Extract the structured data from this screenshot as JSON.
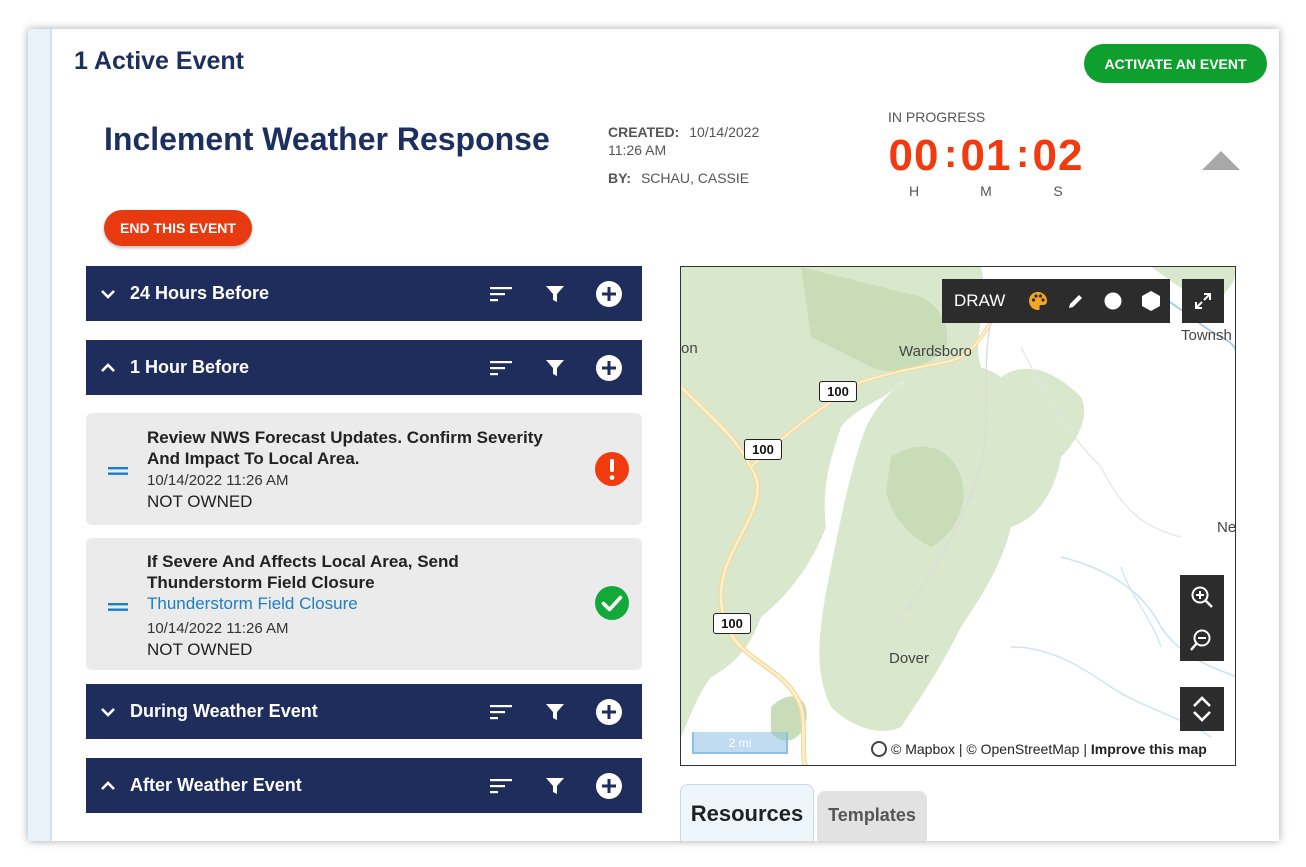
{
  "header": {
    "page_title": "1 Active Event",
    "activate_label": "ACTIVATE AN EVENT"
  },
  "event": {
    "name": "Inclement Weather Response",
    "created_label": "CREATED:",
    "created_date": "10/14/2022",
    "created_time": "11:26 AM",
    "by_label": "BY:",
    "by_value": "SCHAU, CASSIE",
    "status_label": "IN PROGRESS",
    "timer": {
      "h": "00",
      "m": "01",
      "s": "02",
      "h_label": "H",
      "m_label": "M",
      "s_label": "S"
    },
    "end_label": "END THIS EVENT"
  },
  "phases": [
    {
      "title": "24 Hours Before",
      "expanded": false
    },
    {
      "title": "1 Hour Before",
      "expanded": true
    },
    {
      "title": "During Weather Event",
      "expanded": false
    },
    {
      "title": "After Weather Event",
      "expanded": true
    }
  ],
  "tasks": [
    {
      "title": "Review NWS Forecast Updates. Confirm Severity And Impact To Local Area.",
      "link": "",
      "date": "10/14/2022 11:26 AM",
      "owner": "NOT OWNED",
      "status": "alert"
    },
    {
      "title": "If Severe And Affects Local Area, Send Thunderstorm Field Closure",
      "link": "Thunderstorm Field Closure",
      "date": "10/14/2022 11:26 AM",
      "owner": "NOT OWNED",
      "status": "done"
    }
  ],
  "map": {
    "draw_label": "DRAW",
    "places": [
      "Wardsboro",
      "Townsh",
      "Dover",
      "Ne",
      "on"
    ],
    "route_shields": [
      "100",
      "100",
      "100"
    ],
    "scale_label": "2 mi",
    "attribution": "© Mapbox | © OpenStreetMap |",
    "improve_label": "Improve this map",
    "tools": [
      "palette-icon",
      "pencil-icon",
      "circle-icon",
      "polygon-icon",
      "fullscreen-icon",
      "zoom-in-icon",
      "zoom-out-icon",
      "locate-icon"
    ]
  },
  "tabs": {
    "resources": "Resources",
    "templates": "Templates"
  },
  "colors": {
    "navy": "#1e2d5c",
    "activate_green": "#0e9f2e",
    "end_red": "#e83a10",
    "timer_red": "#f23a0f",
    "alert_red": "#f23a0f",
    "done_green": "#12a83a",
    "link_blue": "#1b7fc4"
  }
}
